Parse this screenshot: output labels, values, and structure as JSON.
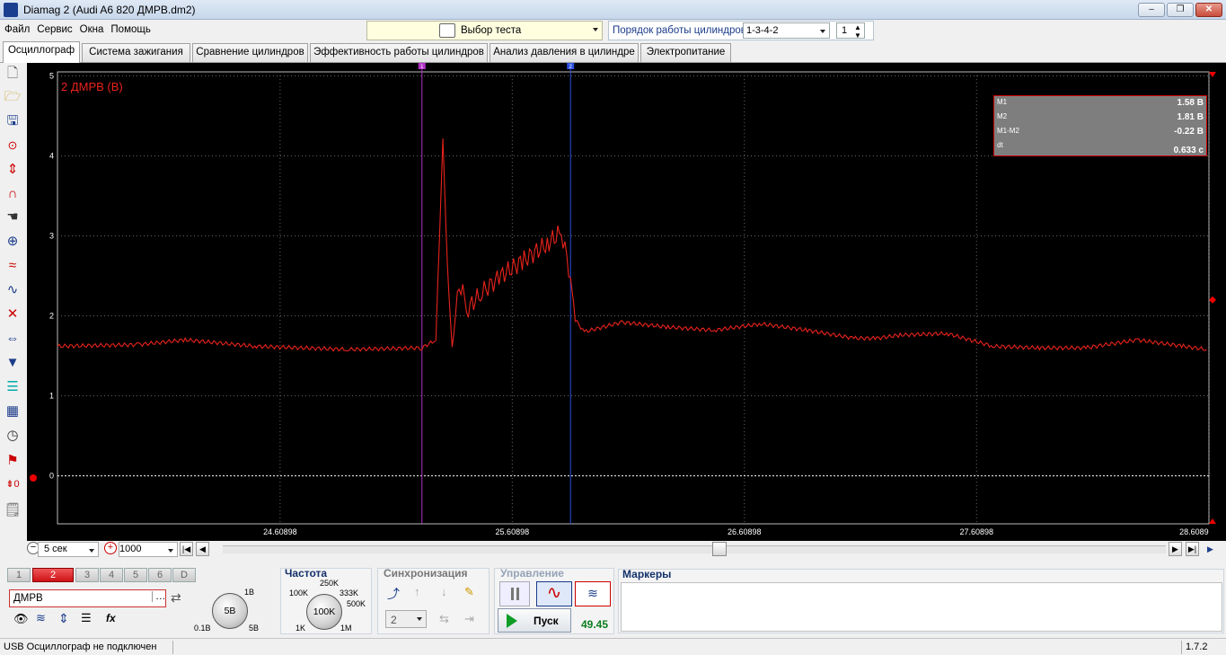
{
  "window": {
    "title": "Diamag 2 (Audi A6 820 ДМРВ.dm2)",
    "min_label": "–",
    "max_label": "❐",
    "close_label": "✕"
  },
  "menu": [
    "Файл",
    "Сервис",
    "Окна",
    "Помощь"
  ],
  "test_select": {
    "label": "Выбор теста"
  },
  "cyl_order": {
    "label": "Порядок работы цилиндров",
    "value": "1-3-4-2",
    "cylinder": "1"
  },
  "tabs": [
    "Осциллограф",
    "Система зажигания",
    "Сравнение цилиндров",
    "Эффективность работы цилиндров",
    "Анализ давления в цилиндре",
    "Электропитание"
  ],
  "active_tab": 0,
  "scope": {
    "channel_label": "2 ДМРВ (В)",
    "y_ticks": [
      "5",
      "4",
      "3",
      "2",
      "1",
      "0"
    ],
    "x_ticks": [
      "24.60898",
      "25.60898",
      "26.60898",
      "27.60898",
      "28.6089"
    ],
    "marker1_label": "1",
    "marker2_label": "2",
    "trace_color": "#e8231c",
    "zero_line_color": "#ffffff",
    "measurements": [
      {
        "name": "M1",
        "value": "1.58 В"
      },
      {
        "name": "M2",
        "value": "1.81 В"
      },
      {
        "name": "M1-M2",
        "value": "-0.22 В"
      },
      {
        "name": "dt",
        "value": "0.633 с"
      }
    ]
  },
  "chart_data": {
    "type": "line",
    "title": "2 ДМРВ (В)",
    "xlabel": "",
    "ylabel": "",
    "xlim": [
      23.65,
      28.61
    ],
    "ylim": [
      -0.6,
      5.05
    ],
    "x_ticks": [
      24.60898,
      25.60898,
      26.60898,
      27.60898,
      28.6089
    ],
    "series": [
      {
        "name": "2 ДМРВ (В)",
        "x": [
          23.65,
          24.0,
          24.2,
          24.5,
          24.9,
          25.22,
          25.28,
          25.31,
          25.33,
          25.35,
          25.38,
          25.42,
          25.48,
          25.56,
          25.66,
          25.76,
          25.82,
          25.86,
          25.88,
          25.92,
          26.08,
          26.28,
          26.48,
          26.68,
          26.88,
          27.08,
          27.18,
          27.28,
          27.48,
          27.68,
          27.88,
          28.08,
          28.3,
          28.5,
          28.6
        ],
        "y": [
          1.62,
          1.64,
          1.7,
          1.62,
          1.58,
          1.6,
          1.7,
          4.2,
          2.6,
          1.6,
          2.4,
          2.1,
          2.3,
          2.5,
          2.7,
          2.9,
          3.05,
          2.5,
          1.95,
          1.8,
          1.92,
          1.86,
          1.82,
          1.9,
          1.82,
          1.72,
          1.72,
          1.76,
          1.78,
          1.62,
          1.6,
          1.6,
          1.7,
          1.62,
          1.58
        ]
      }
    ],
    "markers": [
      {
        "name": "M1",
        "x": 25.22
      },
      {
        "name": "M2",
        "x": 25.86
      }
    ]
  },
  "timebar": {
    "time_value": "5 сек",
    "points_value": "1000"
  },
  "channels": {
    "buttons": [
      "1",
      "2",
      "3",
      "4",
      "5",
      "6",
      "D"
    ],
    "active": "2",
    "name": "ДМРВ",
    "scale_value": "5В",
    "scale_min": "0.1В",
    "scale_max1": "1В",
    "scale_max2": "5В"
  },
  "frequency": {
    "title": "Частота",
    "value": "100K",
    "labels": [
      "100K",
      "250K",
      "333K",
      "500K",
      "1K",
      "1M"
    ]
  },
  "sync": {
    "title": "Синхронизация",
    "channel": "2"
  },
  "control": {
    "title": "Управление",
    "run_label": "Пуск",
    "fps": "49.45"
  },
  "markers_panel": {
    "title": "Маркеры"
  },
  "status": {
    "text": "USB Осциллограф не подключен",
    "version": "1.7.2"
  }
}
